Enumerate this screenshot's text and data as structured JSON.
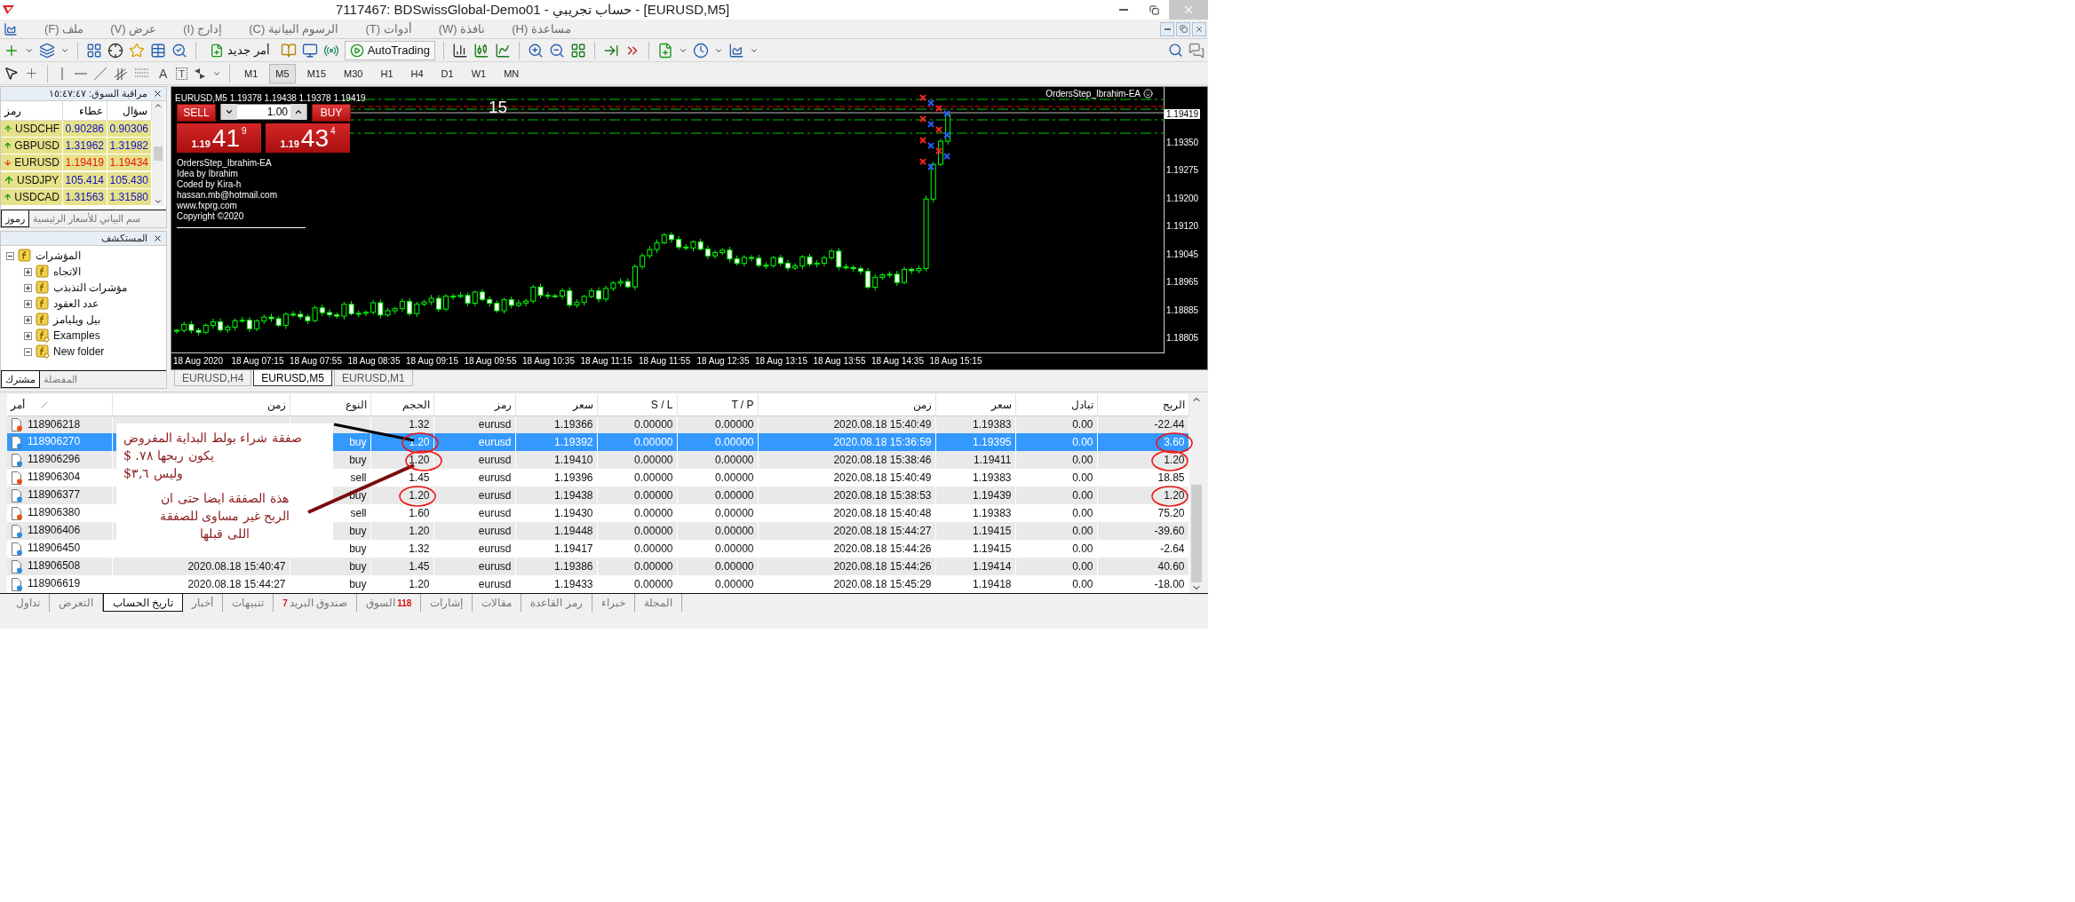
{
  "window": {
    "title": "7117467: BDSwissGlobal-Demo01 - حساب تجريبي - [EURUSD,M5]"
  },
  "menu": [
    "مساعدة (H)",
    "نافذة (W)",
    "أدوات (T)",
    "الرسوم البيانية (C)",
    "إدارج (I)",
    "عرض (V)",
    "ملف (F)"
  ],
  "toolbar": {
    "new_order": "أمر جديد",
    "autotrading": "AutoTrading",
    "text_tool": "A",
    "label_tool": "T"
  },
  "periods": [
    {
      "label": "M1",
      "selected": false
    },
    {
      "label": "M5",
      "selected": true
    },
    {
      "label": "M15",
      "selected": false
    },
    {
      "label": "M30",
      "selected": false
    },
    {
      "label": "H1",
      "selected": false
    },
    {
      "label": "H4",
      "selected": false
    },
    {
      "label": "D1",
      "selected": false
    },
    {
      "label": "W1",
      "selected": false
    },
    {
      "label": "MN",
      "selected": false
    }
  ],
  "market_watch": {
    "title": "مراقبة السوق: ١٥:٤٧:٤٧",
    "columns": [
      "سؤال",
      "عطاء",
      "رمز"
    ],
    "rows": [
      {
        "symbol": "USDCHF",
        "bid": "0.90286",
        "ask": "0.90306",
        "kind": "up"
      },
      {
        "symbol": "GBPUSD",
        "bid": "1.31962",
        "ask": "1.31982",
        "kind": "up"
      },
      {
        "symbol": "EURUSD",
        "bid": "1.19419",
        "ask": "1.19434",
        "kind": "down"
      },
      {
        "symbol": "USDJPY",
        "bid": "105.414",
        "ask": "105.430",
        "kind": "up"
      },
      {
        "symbol": "USDCAD",
        "bid": "1.31563",
        "ask": "1.31580",
        "kind": "up"
      }
    ],
    "tabs": [
      {
        "label": "سم البياني للأسعار الرئيسية",
        "selected": false
      },
      {
        "label": "رموز",
        "selected": true
      }
    ]
  },
  "navigator": {
    "title": "المستكشف",
    "tree": [
      {
        "label": "المؤشرات",
        "kind": "category",
        "expanded": true,
        "children": [
          {
            "label": "الاتجاه",
            "kind": "category",
            "expanded": false
          },
          {
            "label": "مؤشرات التذبذب",
            "kind": "category",
            "expanded": false
          },
          {
            "label": "عدد العقود",
            "kind": "category",
            "expanded": false
          },
          {
            "label": "بيل ويليامز",
            "kind": "category",
            "expanded": false
          },
          {
            "label": "Examples",
            "kind": "folder",
            "expanded": false
          },
          {
            "label": "New folder",
            "kind": "folder",
            "expanded": true
          }
        ]
      }
    ],
    "tabs": [
      {
        "label": "المفضلة",
        "selected": false
      },
      {
        "label": "مشترك",
        "selected": true
      }
    ]
  },
  "chart": {
    "header": "EURUSD,M5  1.19378 1.19438 1.19378 1.19419",
    "expert": "OrdersStep_Ibrahim-EA",
    "counter": "15",
    "trade_panel": {
      "sell": "SELL",
      "buy": "BUY",
      "lots": "1.00",
      "bid": {
        "prefix": "1.19",
        "big": "41",
        "sup": "9"
      },
      "ask": {
        "prefix": "1.19",
        "big": "43",
        "sup": "4"
      }
    },
    "info": [
      "OrdersStep_Ibrahim-EA",
      "Idea by Ibrahim",
      "Coded by Kira-h",
      "hassan.mb@hotmail.com",
      "www.fxprg.com",
      "Copyright ©2020"
    ],
    "price_labels": [
      {
        "value": "1.19419",
        "current": true
      },
      {
        "value": "1.19350",
        "current": false
      },
      {
        "value": "1.19275",
        "current": false
      },
      {
        "value": "1.19200",
        "current": false
      },
      {
        "value": "1.19120",
        "current": false
      },
      {
        "value": "1.19045",
        "current": false
      },
      {
        "value": "1.18965",
        "current": false
      },
      {
        "value": "1.18885",
        "current": false
      },
      {
        "value": "1.18805",
        "current": false
      }
    ],
    "time_labels": [
      "18 Aug 2020",
      "18 Aug 07:15",
      "18 Aug 07:55",
      "18 Aug 08:35",
      "18 Aug 09:15",
      "18 Aug 09:55",
      "18 Aug 10:35",
      "18 Aug 11:15",
      "18 Aug 11:55",
      "18 Aug 12:35",
      "18 Aug 13:15",
      "18 Aug 13:55",
      "18 Aug 14:35",
      "18 Aug 15:15"
    ]
  },
  "chart_tabs": [
    {
      "label": "EURUSD,H4",
      "selected": false
    },
    {
      "label": "EURUSD,M5",
      "selected": true
    },
    {
      "label": "EURUSD,M1",
      "selected": false
    }
  ],
  "terminal": {
    "columns": [
      "الربح",
      "تبادل",
      "سعر",
      "زمن",
      "T / P",
      "S / L",
      "سعر",
      "رمز",
      "الحجم",
      "النوع",
      "زمن",
      "أمر"
    ],
    "rows": [
      {
        "kind": "sell",
        "selected": false,
        "order": "118906218",
        "volume": "1.32",
        "symbol": "eurusd",
        "open_price": "1.19366",
        "sl": "0.00000",
        "tp": "0.00000",
        "close_time": "2020.08.18 15:40:49",
        "close_price": "1.19383",
        "swap": "0.00",
        "profit": "-22.44"
      },
      {
        "kind": "buy",
        "selected": true,
        "order": "118906270",
        "type": "buy",
        "volume": "1.20",
        "symbol": "eurusd",
        "open_price": "1.19392",
        "sl": "0.00000",
        "tp": "0.00000",
        "close_time": "2020.08.18 15:36:59",
        "close_price": "1.19395",
        "swap": "0.00",
        "profit": "3.60"
      },
      {
        "kind": "buy",
        "selected": false,
        "order": "118906296",
        "type": "buy",
        "volume": "1.20",
        "symbol": "eurusd",
        "open_price": "1.19410",
        "sl": "0.00000",
        "tp": "0.00000",
        "close_time": "2020.08.18 15:38:46",
        "close_price": "1.19411",
        "swap": "0.00",
        "profit": "1.20"
      },
      {
        "kind": "sell",
        "selected": false,
        "order": "118906304",
        "type": "sell",
        "volume": "1.45",
        "symbol": "eurusd",
        "open_price": "1.19396",
        "sl": "0.00000",
        "tp": "0.00000",
        "close_time": "2020.08.18 15:40:49",
        "close_price": "1.19383",
        "swap": "0.00",
        "profit": "18.85"
      },
      {
        "kind": "buy",
        "selected": false,
        "order": "118906377",
        "type": "buy",
        "volume": "1.20",
        "symbol": "eurusd",
        "open_price": "1.19438",
        "sl": "0.00000",
        "tp": "0.00000",
        "close_time": "2020.08.18 15:38:53",
        "close_price": "1.19439",
        "swap": "0.00",
        "profit": "1.20"
      },
      {
        "kind": "sell",
        "selected": false,
        "order": "118906380",
        "type": "sell",
        "volume": "1.60",
        "symbol": "eurusd",
        "open_price": "1.19430",
        "sl": "0.00000",
        "tp": "0.00000",
        "close_time": "2020.08.18 15:40:48",
        "close_price": "1.19383",
        "swap": "0.00",
        "profit": "75.20"
      },
      {
        "kind": "buy",
        "selected": false,
        "order": "118906406",
        "type": "buy",
        "volume": "1.20",
        "symbol": "eurusd",
        "open_price": "1.19448",
        "sl": "0.00000",
        "tp": "0.00000",
        "close_time": "2020.08.18 15:44:27",
        "close_price": "1.19415",
        "swap": "0.00",
        "profit": "-39.60"
      },
      {
        "kind": "buy",
        "selected": false,
        "order": "118906450",
        "type": "buy",
        "volume": "1.32",
        "symbol": "eurusd",
        "open_price": "1.19417",
        "sl": "0.00000",
        "tp": "0.00000",
        "close_time": "2020.08.18 15:44:26",
        "close_price": "1.19415",
        "swap": "0.00",
        "profit": "-2.64"
      },
      {
        "kind": "buy",
        "selected": false,
        "order": "118906508",
        "open_time": "2020.08.18 15:40:47",
        "type": "buy",
        "volume": "1.45",
        "symbol": "eurusd",
        "open_price": "1.19386",
        "sl": "0.00000",
        "tp": "0.00000",
        "close_time": "2020.08.18 15:44:26",
        "close_price": "1.19414",
        "swap": "0.00",
        "profit": "40.60"
      },
      {
        "kind": "buy",
        "selected": false,
        "order": "118906619",
        "open_time": "2020.08.18 15:44:27",
        "type": "buy",
        "volume": "1.20",
        "symbol": "eurusd",
        "open_price": "1.19433",
        "sl": "0.00000",
        "tp": "0.00000",
        "close_time": "2020.08.18 15:45:29",
        "close_price": "1.19418",
        "swap": "0.00",
        "profit": "-18.00"
      }
    ],
    "notes": [
      "صفقة شراء بولط البداية المفروض\nيكون ربحها ٧٨. $\nوليس ٣,٦$",
      "هذة الصفقة ايضا حتى ان\nالربح غير مساوى للصفقة\nاللى قبلها"
    ],
    "tabs": [
      {
        "label": "المجلة",
        "selected": false
      },
      {
        "label": "خبراء",
        "selected": false
      },
      {
        "label": "رمز القاعدة",
        "selected": false
      },
      {
        "label": "مقالات",
        "selected": false
      },
      {
        "label": "إشارات",
        "selected": false
      },
      {
        "label": "السوق",
        "badge": "118",
        "kind": "badge-right",
        "selected": false
      },
      {
        "label": "صندوق البريد",
        "count": "7",
        "kind": "badge-left",
        "selected": false
      },
      {
        "label": "تنبيهات",
        "selected": false
      },
      {
        "label": "أخبار",
        "selected": false
      },
      {
        "label": "تاريخ الحساب",
        "selected": true
      },
      {
        "label": "التعرض",
        "selected": false
      },
      {
        "label": "تداول",
        "selected": false
      }
    ]
  }
}
